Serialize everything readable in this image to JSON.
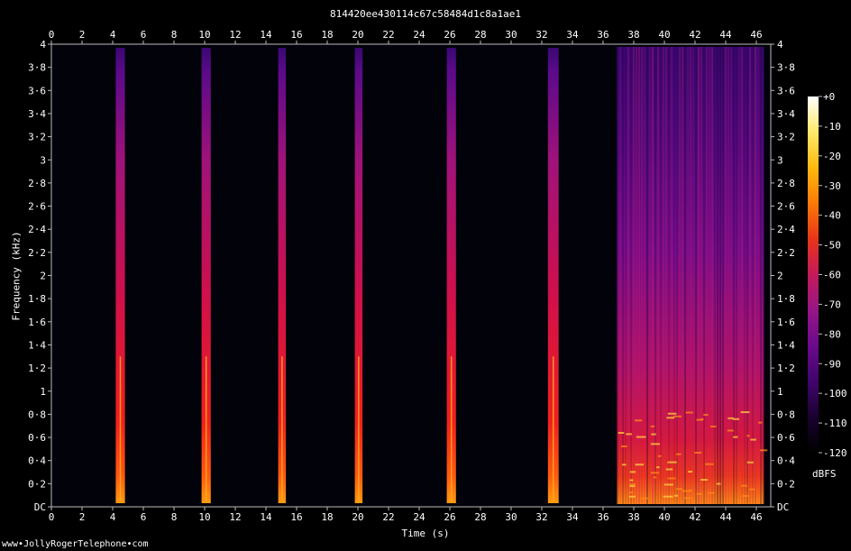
{
  "chart_data": {
    "type": "heatmap",
    "title": "814420ee430114c67c58484d1c8a1ae1",
    "xlabel": "Time (s)",
    "ylabel": "Frequency (kHz)",
    "xlim": [
      0,
      47
    ],
    "ylim": [
      0,
      4
    ],
    "x_ticks": [
      "0",
      "2",
      "4",
      "6",
      "8",
      "10",
      "12",
      "14",
      "16",
      "18",
      "20",
      "22",
      "24",
      "26",
      "28",
      "30",
      "32",
      "34",
      "36",
      "38",
      "40",
      "42",
      "44",
      "46"
    ],
    "y_ticks": [
      "DC",
      "0·2",
      "0·4",
      "0·6",
      "0·8",
      "1",
      "1·2",
      "1·4",
      "1·6",
      "1·8",
      "2",
      "2·2",
      "2·4",
      "2·6",
      "2·8",
      "3",
      "3·2",
      "3·4",
      "3·6",
      "3·8",
      "4"
    ],
    "colorbar": {
      "unit": "dBFS",
      "ticks": [
        "+0",
        "-10",
        "-20",
        "-30",
        "-40",
        "-50",
        "-60",
        "-70",
        "-80",
        "-90",
        "-100",
        "-110",
        "-120"
      ],
      "colors": [
        "#000000",
        "#1a0230",
        "#40046c",
        "#6a0a8c",
        "#961686",
        "#c41a5a",
        "#e8341a",
        "#fb7a08",
        "#feb90e",
        "#ffe86a",
        "#ffffff"
      ]
    },
    "tone_bursts": [
      {
        "start": 4.2,
        "end": 4.8
      },
      {
        "start": 9.8,
        "end": 10.4
      },
      {
        "start": 14.8,
        "end": 15.3
      },
      {
        "start": 19.8,
        "end": 20.3
      },
      {
        "start": 25.8,
        "end": 26.4
      },
      {
        "start": 32.4,
        "end": 33.1
      }
    ],
    "broadband_segment": {
      "start": 36.9,
      "end": 46.5
    }
  },
  "credit": "www•JollyRogerTelephone•com"
}
